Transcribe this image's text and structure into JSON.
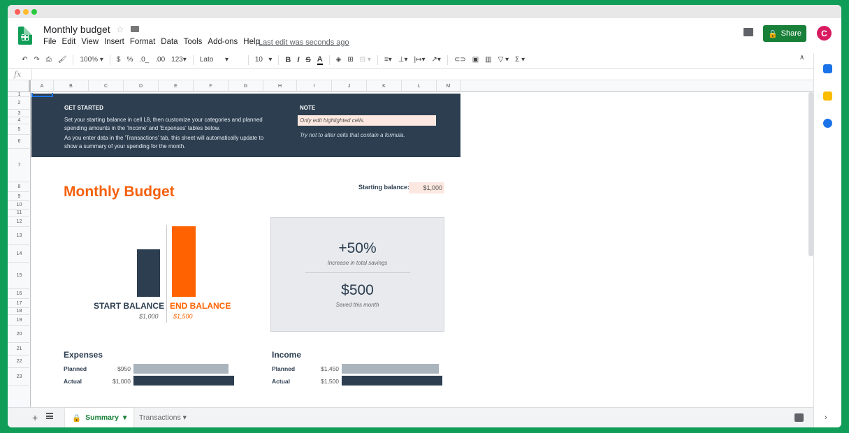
{
  "app": {
    "doc_title": "Monthly budget",
    "menus": [
      "File",
      "Edit",
      "View",
      "Insert",
      "Format",
      "Data",
      "Tools",
      "Add-ons",
      "Help"
    ],
    "last_edit": "Last edit was seconds ago",
    "share_label": "Share",
    "avatar_letter": "C"
  },
  "toolbar": {
    "zoom": "100%",
    "currency": "$",
    "percent": "%",
    "dec_less": ".0_",
    "dec_more": ".00",
    "format_more": "123",
    "font": "Lato",
    "font_size": "10",
    "bold": "B",
    "italic": "I",
    "strike": "S",
    "text_color": "A",
    "sum": "Σ"
  },
  "formula_bar": {
    "fx": "fx",
    "value": ""
  },
  "columns": [
    "A",
    "B",
    "C",
    "D",
    "E",
    "F",
    "G",
    "H",
    "I",
    "J",
    "K",
    "L",
    "M"
  ],
  "rows": [
    "1",
    "2",
    "3",
    "4",
    "5",
    "6",
    "7",
    "8",
    "9",
    "10",
    "11",
    "12",
    "13",
    "14",
    "15",
    "16",
    "17",
    "18",
    "19",
    "20",
    "21",
    "22",
    "23"
  ],
  "banner": {
    "get_started_heading": "GET STARTED",
    "get_started_p1": "Set your starting balance in cell L8, then customize your categories and planned spending amounts in the 'Income' and 'Expenses' tables below.",
    "get_started_p2": "As you enter data in the 'Transactions' tab, this sheet will automatically update to show a summary of your spending for the month.",
    "note_heading": "NOTE",
    "note_cell": "Only edit highlighted cells.",
    "note_sub": "Try not to alter cells that contain a formula."
  },
  "summary": {
    "title": "Monthly Budget",
    "starting_balance_label": "Starting balance:",
    "starting_balance_value": "$1,000",
    "start_label": "START BALANCE",
    "end_label": "END BALANCE",
    "start_value": "$1,000",
    "end_value": "$1,500",
    "stat1_value": "+50%",
    "stat1_caption": "Increase in total savings",
    "stat2_value": "$500",
    "stat2_caption": "Saved this month"
  },
  "expenses": {
    "heading": "Expenses",
    "planned_label": "Planned",
    "planned_value": "$950",
    "actual_label": "Actual",
    "actual_value": "$1,000"
  },
  "income": {
    "heading": "Income",
    "planned_label": "Planned",
    "planned_value": "$1,450",
    "actual_label": "Actual",
    "actual_value": "$1,500"
  },
  "sheet_tabs": {
    "active": "Summary",
    "other": "Transactions"
  },
  "colors": {
    "navy": "#2c3e50",
    "orange": "#ff6200",
    "highlight": "#fce8e0",
    "grey_bar": "#aab4bd",
    "sheets_green": "#0f9d58"
  },
  "icons": [
    "undo-icon",
    "redo-icon",
    "print-icon",
    "paint-format-icon",
    "comment-icon",
    "lock-icon",
    "calendar-icon",
    "keep-icon",
    "tasks-icon",
    "explore-icon"
  ]
}
